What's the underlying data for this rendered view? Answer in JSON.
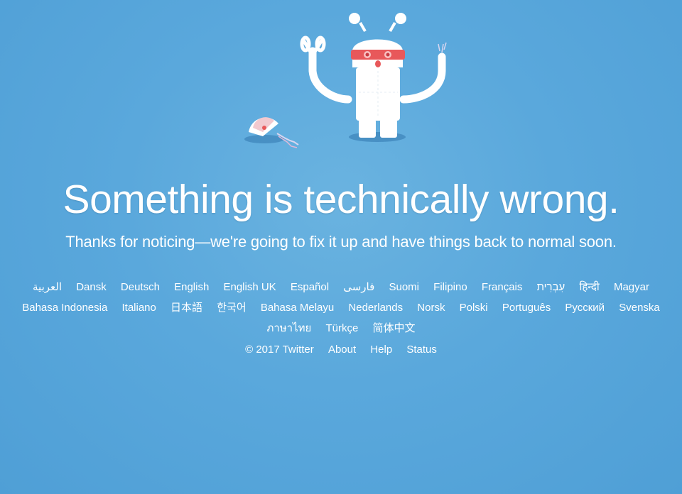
{
  "headline": "Something is technically wrong.",
  "subline": "Thanks for noticing—we're going to fix it up and have things back to normal soon.",
  "languages": [
    "العربية",
    "Dansk",
    "Deutsch",
    "English",
    "English UK",
    "Español",
    "فارسی",
    "Suomi",
    "Filipino",
    "Français",
    "עִבְרִית",
    "हिन्दी",
    "Magyar",
    "Bahasa Indonesia",
    "Italiano",
    "日本語",
    "한국어",
    "Bahasa Melayu",
    "Nederlands",
    "Norsk",
    "Polski",
    "Português",
    "Русский",
    "Svenska",
    "ภาษาไทย",
    "Türkçe",
    "简体中文"
  ],
  "footer": {
    "copyright": "© 2017 Twitter",
    "about": "About",
    "help": "Help",
    "status": "Status"
  },
  "colors": {
    "background": "#5aa8dc",
    "text": "#ffffff",
    "robot_visor": "#e8585a"
  }
}
